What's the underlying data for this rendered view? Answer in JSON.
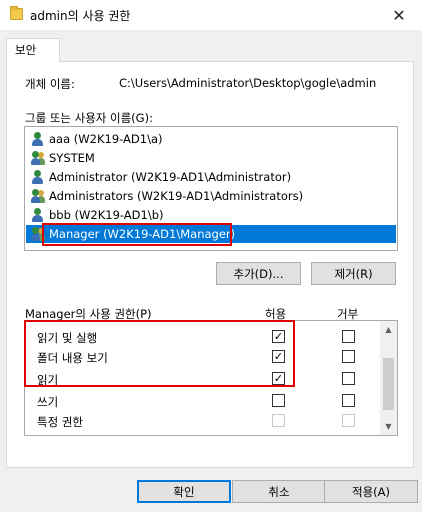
{
  "window": {
    "title": "admin의 사용 권한",
    "close_glyph": "✕"
  },
  "tabs": [
    {
      "label": "보안",
      "active": true
    }
  ],
  "object": {
    "label": "개체 이름:",
    "value": "C:\\Users\\Administrator\\Desktop\\gogle\\admin"
  },
  "groups": {
    "label": "그룹 또는 사용자 이름(G):",
    "items": [
      {
        "label": "aaa (W2K19-AD1\\a)",
        "icon": "user-icon",
        "selected": false
      },
      {
        "label": "SYSTEM",
        "icon": "group-icon",
        "selected": false
      },
      {
        "label": "Administrator (W2K19-AD1\\Administrator)",
        "icon": "user-icon",
        "selected": false
      },
      {
        "label": "Administrators (W2K19-AD1\\Administrators)",
        "icon": "group-icon",
        "selected": false
      },
      {
        "label": "bbb (W2K19-AD1\\b)",
        "icon": "user-icon",
        "selected": false
      },
      {
        "label": "Manager (W2K19-AD1\\Manager)",
        "icon": "group-icon",
        "selected": true
      }
    ]
  },
  "buttons": {
    "add": "추가(D)...",
    "remove": "제거(R)",
    "ok": "확인",
    "cancel": "취소",
    "apply": "적용(A)"
  },
  "permissions": {
    "label": "Manager의 사용 권한(P)",
    "allow_header": "허용",
    "deny_header": "거부",
    "check_glyph": "✓",
    "rows": [
      {
        "name": "읽기 및 실행",
        "allow": true,
        "deny": false,
        "disabled": false
      },
      {
        "name": "폴더 내용 보기",
        "allow": true,
        "deny": false,
        "disabled": false
      },
      {
        "name": "읽기",
        "allow": true,
        "deny": false,
        "disabled": false
      },
      {
        "name": "쓰기",
        "allow": false,
        "deny": false,
        "disabled": false
      },
      {
        "name": "특정 권한",
        "allow": false,
        "deny": false,
        "disabled": true
      }
    ]
  },
  "colors": {
    "selection": "#0078d7",
    "highlight": "#e00000"
  }
}
